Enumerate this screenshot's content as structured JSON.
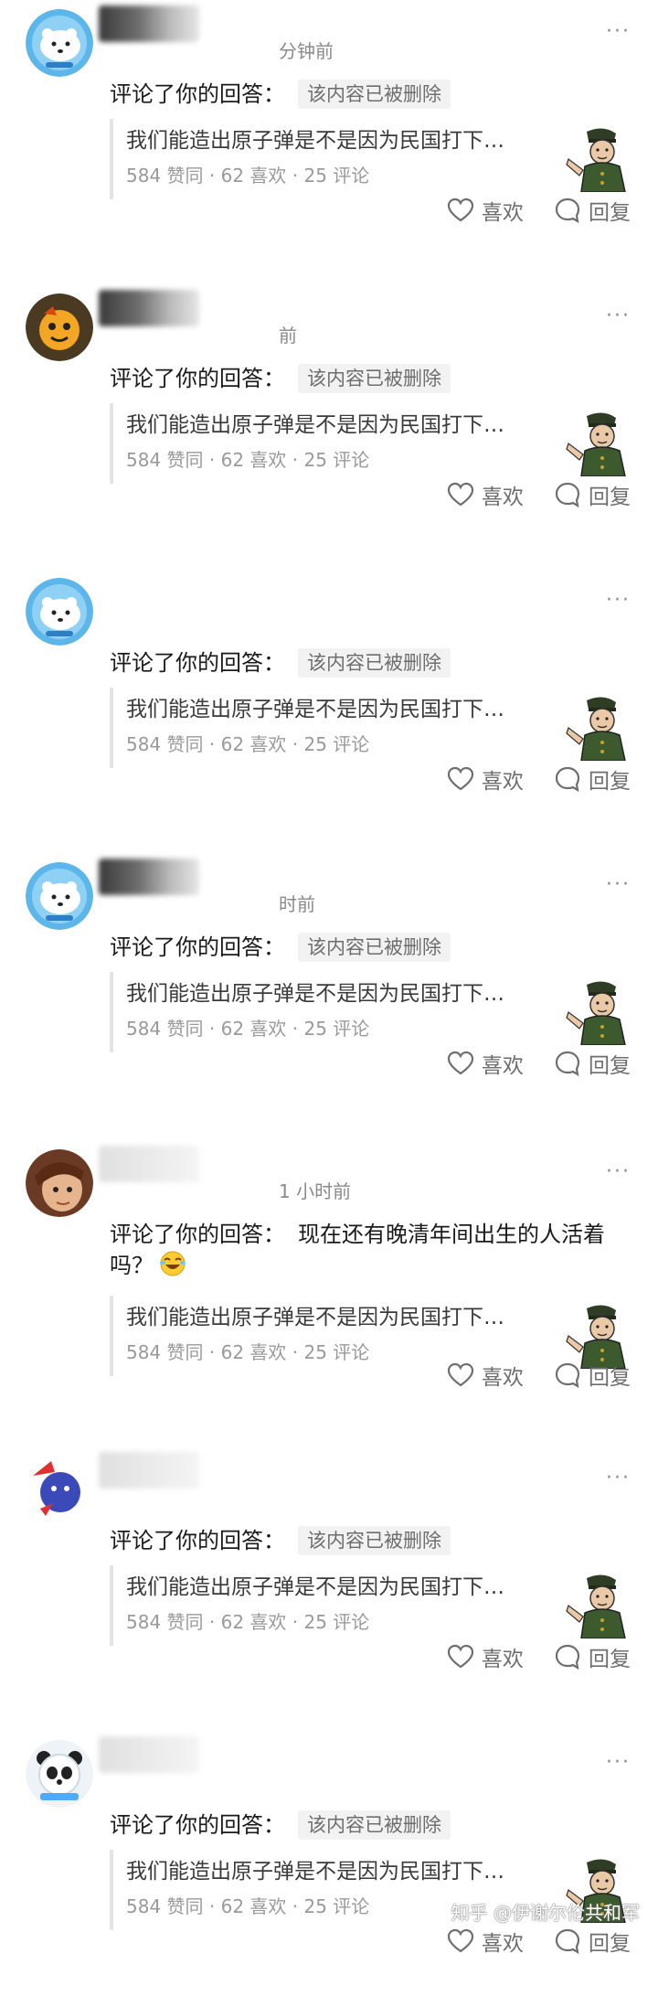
{
  "strings": {
    "comment_prefix": "评论了你的回答：",
    "deleted_label": "该内容已被删除",
    "quote_title": "我们能造出原子弹是不是因为民国打下…",
    "quote_stats": "584 赞同 · 62 喜欢 · 25 评论",
    "like_label": "喜欢",
    "reply_label": "回复",
    "more_label": "···"
  },
  "notifications": [
    {
      "avatar": "polar-bear-avatar",
      "name_mask": "dark",
      "time": "分钟前",
      "text": ""
    },
    {
      "avatar": "orange-cartoon-avatar",
      "name_mask": "dark",
      "time": "前",
      "text": ""
    },
    {
      "avatar": "polar-bear-avatar",
      "name_mask": "none",
      "time": "",
      "text": ""
    },
    {
      "avatar": "polar-bear-avatar",
      "name_mask": "dark",
      "time": "时前",
      "text": ""
    },
    {
      "avatar": "anime-boy-avatar",
      "name_mask": "light",
      "time": "1 小时前",
      "text": "现在还有晚清年间出生的人活着吗？"
    },
    {
      "avatar": "blue-blob-avatar",
      "name_mask": "light",
      "time": "",
      "text": ""
    },
    {
      "avatar": "panda-avatar",
      "name_mask": "light",
      "time": "",
      "text": ""
    }
  ],
  "watermark": "知乎 @伊谢尔伦共和军",
  "colors": {
    "accent_text": "#1a1a1a",
    "muted": "#8a8a8a",
    "deleted_bg": "#f2f2f2"
  }
}
